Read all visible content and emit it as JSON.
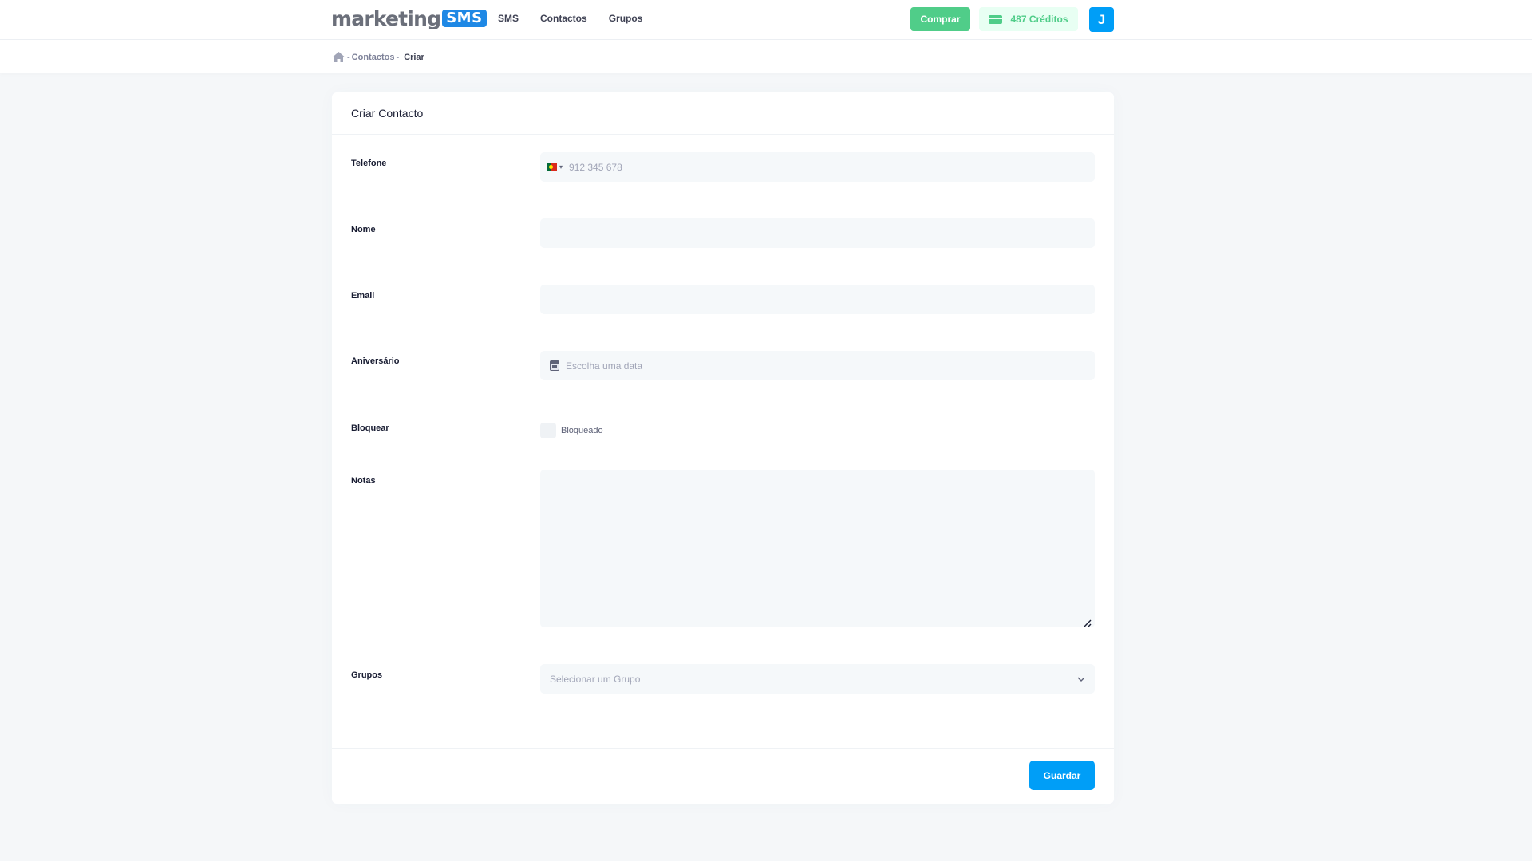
{
  "header": {
    "logo_text": "marketing",
    "logo_badge": "SMS",
    "nav": [
      {
        "label": "SMS"
      },
      {
        "label": "Contactos"
      },
      {
        "label": "Grupos"
      }
    ],
    "buy_label": "Comprar",
    "credits_label": "487 Créditos",
    "avatar_initial": "J"
  },
  "breadcrumb": {
    "separator": "-",
    "contacts": "Contactos",
    "current": "Criar"
  },
  "form": {
    "title": "Criar Contacto",
    "phone": {
      "label": "Telefone",
      "placeholder": "912 345 678",
      "country": "PT",
      "arrow": "▾"
    },
    "name": {
      "label": "Nome",
      "value": ""
    },
    "email": {
      "label": "Email",
      "value": ""
    },
    "birthday": {
      "label": "Aniversário",
      "placeholder": "Escolha uma data"
    },
    "block": {
      "label": "Bloquear",
      "checkbox_label": "Bloqueado",
      "checked": false
    },
    "notes": {
      "label": "Notas",
      "value": ""
    },
    "groups": {
      "label": "Grupos",
      "selected": "Selecionar um Grupo"
    },
    "save_label": "Guardar"
  },
  "colors": {
    "primary": "#009ef7",
    "success": "#50cd89",
    "success_light": "#e8fff3",
    "brand_blue": "#1e88e5",
    "page_bg": "#f5f7f9",
    "input_bg": "#f5f8fa"
  },
  "icons": {
    "home": "home-icon",
    "credits": "credit-card-icon",
    "calendar": "calendar-icon",
    "flag": "portugal-flag-icon",
    "select": "chevron-down-icon",
    "resize": "resize-handle-icon"
  }
}
